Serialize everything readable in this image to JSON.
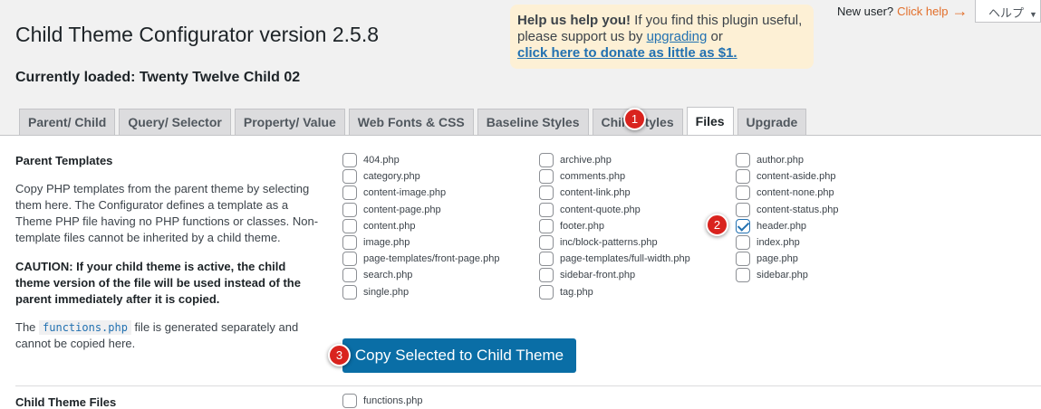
{
  "title": "Child Theme Configurator version 2.5.8",
  "currently_loaded": "Currently loaded: Twenty Twelve Child 02",
  "help_box": {
    "strong": "Help us help you!",
    "text1": " If you find this plugin useful, please support us by ",
    "upgrading_link": "upgrading",
    "text2": " or ",
    "donate_link": "click here to donate as little as $1."
  },
  "new_user": {
    "text": "New user?",
    "link": "Click help",
    "icon": "arrow-right-icon"
  },
  "help_tab": "ヘルプ",
  "tabs": [
    {
      "label": "Parent/ Child",
      "active": false
    },
    {
      "label": "Query/ Selector",
      "active": false
    },
    {
      "label": "Property/ Value",
      "active": false
    },
    {
      "label": "Web Fonts & CSS",
      "active": false
    },
    {
      "label": "Baseline Styles",
      "active": false
    },
    {
      "label": "Child Styles",
      "active": false
    },
    {
      "label": "Files",
      "active": true
    },
    {
      "label": "Upgrade",
      "active": false
    }
  ],
  "parent_templates": {
    "heading": "Parent Templates",
    "desc": "Copy PHP templates from the parent theme by selecting them here. The Configurator defines a template as a Theme PHP file having no PHP functions or classes. Non-template files cannot be inherited by a child theme.",
    "caution": "CAUTION: If your child theme is active, the child theme version of the file will be used instead of the parent immediately after it is copied.",
    "note_pre": "The ",
    "note_code": "functions.php",
    "note_post": " file is generated separately and cannot be copied here.",
    "columns": [
      [
        {
          "file": "404.php",
          "checked": false
        },
        {
          "file": "category.php",
          "checked": false
        },
        {
          "file": "content-image.php",
          "checked": false
        },
        {
          "file": "content-page.php",
          "checked": false
        },
        {
          "file": "content.php",
          "checked": false
        },
        {
          "file": "image.php",
          "checked": false
        },
        {
          "file": "page-templates/front-page.php",
          "checked": false
        },
        {
          "file": "search.php",
          "checked": false
        },
        {
          "file": "single.php",
          "checked": false
        }
      ],
      [
        {
          "file": "archive.php",
          "checked": false
        },
        {
          "file": "comments.php",
          "checked": false
        },
        {
          "file": "content-link.php",
          "checked": false
        },
        {
          "file": "content-quote.php",
          "checked": false
        },
        {
          "file": "footer.php",
          "checked": false
        },
        {
          "file": "inc/block-patterns.php",
          "checked": false
        },
        {
          "file": "page-templates/full-width.php",
          "checked": false
        },
        {
          "file": "sidebar-front.php",
          "checked": false
        },
        {
          "file": "tag.php",
          "checked": false
        }
      ],
      [
        {
          "file": "author.php",
          "checked": false
        },
        {
          "file": "content-aside.php",
          "checked": false
        },
        {
          "file": "content-none.php",
          "checked": false
        },
        {
          "file": "content-status.php",
          "checked": false
        },
        {
          "file": "header.php",
          "checked": true
        },
        {
          "file": "index.php",
          "checked": false
        },
        {
          "file": "page.php",
          "checked": false
        },
        {
          "file": "sidebar.php",
          "checked": false
        }
      ]
    ],
    "copy_button": "Copy Selected to Child Theme"
  },
  "child_theme_files": {
    "heading": "Child Theme Files",
    "files": [
      {
        "file": "functions.php",
        "checked": false
      }
    ]
  },
  "badges": [
    "1",
    "2",
    "3"
  ],
  "colors": {
    "accent": "#2271b1",
    "button": "#0a6ea6",
    "badge": "#d9231e",
    "help_bg": "#fdf0d5",
    "click_help": "#e26f2b"
  }
}
